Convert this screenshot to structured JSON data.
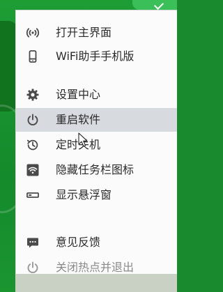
{
  "menu": {
    "items": [
      {
        "label": "打开主界面",
        "icon": "wifi-signal-icon"
      },
      {
        "label": "WiFi助手手机版",
        "icon": "phone-icon"
      },
      {
        "label": "设置中心",
        "icon": "gear-icon"
      },
      {
        "label": "重启软件",
        "icon": "power-icon",
        "highlighted": true
      },
      {
        "label": "定时关机",
        "icon": "history-clock-icon"
      },
      {
        "label": "隐藏任务栏图标",
        "icon": "wifi-icon"
      },
      {
        "label": "显示悬浮窗",
        "icon": "floating-bar-icon"
      },
      {
        "label": "意见反馈",
        "icon": "chat-bubble-icon"
      },
      {
        "label": "关闭热点并退出",
        "icon": "power-icon"
      }
    ]
  },
  "colors": {
    "background_green": "#1a8a2e",
    "menu_background": "#fbfbfb",
    "highlight": "#d7dadf",
    "icon": "#4a4a4a",
    "text": "#2b2b2b"
  }
}
